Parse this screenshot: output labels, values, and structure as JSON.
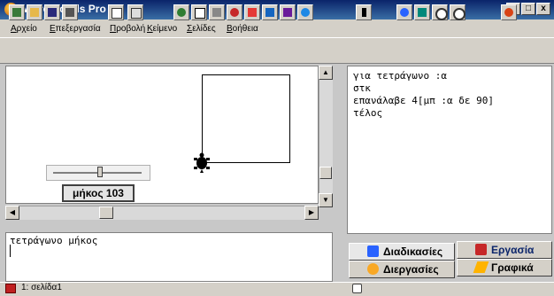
{
  "window": {
    "title": "MicroWorlds Pro",
    "controls": {
      "minimize": "_",
      "maximize": "□",
      "close": "x"
    }
  },
  "menu": {
    "items": [
      {
        "label": "Αρχείο"
      },
      {
        "label": "Επεξεργασία"
      },
      {
        "label": "Προβολή"
      },
      {
        "label": "Κείμενο"
      },
      {
        "label": "Σελίδες"
      },
      {
        "label": "Βοήθεια"
      }
    ]
  },
  "toolbar": {
    "icons": [
      "new-page-icon",
      "open-icon",
      "save-icon",
      "print-icon",
      "page-view-icon",
      "fullscreen-icon",
      "turtle-icon",
      "text-box-icon",
      "graphics-icon",
      "eye-icon",
      "music-icon",
      "pencil-icon",
      "paint-icon",
      "shapes-icon",
      "pointer-icon",
      "eye-tool-icon",
      "stamp-icon",
      "zoom-in-icon",
      "zoom-out-icon",
      "stop-icon"
    ]
  },
  "slider": {
    "label": "μήκος 103",
    "value": 103
  },
  "command_center": {
    "text": "τετράγωνο μήκος"
  },
  "procedures": {
    "lines": [
      "για τετράγωνο :α",
      "στκ",
      "επανάλαβε 4[μπ :α δε 90]",
      "τέλος"
    ]
  },
  "tabs": {
    "procedures": "Διαδικασίες",
    "project": "Εργασία",
    "processes": "Διεργασίες",
    "graphics": "Γραφικά"
  },
  "status": {
    "page": "1: σελίδα1"
  },
  "colors": {
    "title_bar": "#0a246a",
    "panel": "#d4d0c8"
  }
}
